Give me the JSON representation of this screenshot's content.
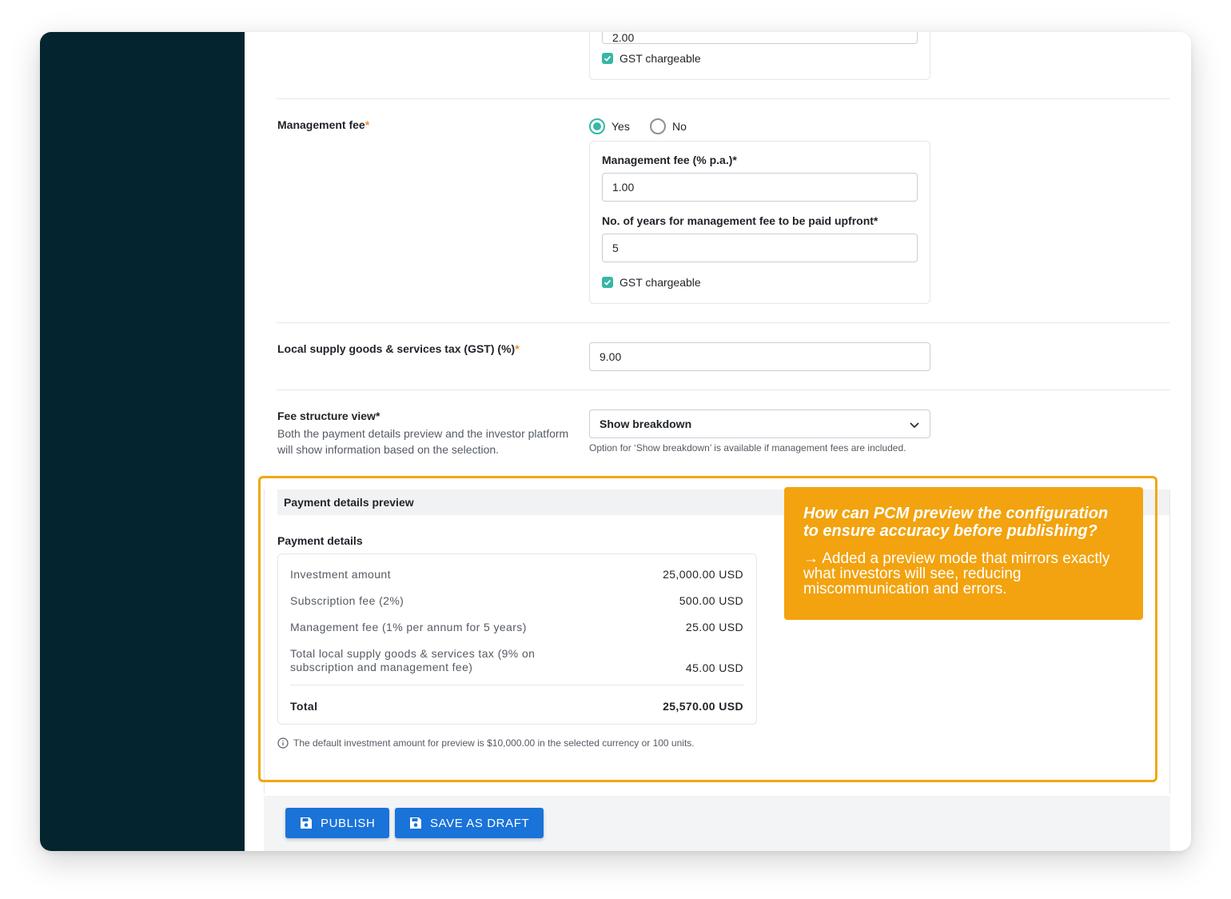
{
  "top_section": {
    "partial_input_value": "2.00",
    "gst_chargeable_label": "GST chargeable"
  },
  "management_fee": {
    "label": "Management fee",
    "required_mark": "*",
    "radio_yes": "Yes",
    "radio_no": "No",
    "selected": "Yes",
    "percent_label": "Management fee (% p.a.)*",
    "percent_value": "1.00",
    "years_label": "No. of years for management fee to be paid upfront*",
    "years_value": "5",
    "gst_chargeable_label": "GST chargeable"
  },
  "gst": {
    "label": "Local supply goods & services tax (GST) (%)",
    "required_mark": "*",
    "value": "9.00"
  },
  "fee_structure": {
    "label": "Fee structure view*",
    "helper": "Both the payment details preview and the investor platform will show information based on the selection.",
    "selected": "Show breakdown",
    "note": "Option for ‘Show breakdown’ is available if management fees are included."
  },
  "preview": {
    "header": "Payment details preview",
    "subheader": "Payment details",
    "rows": [
      {
        "label": "Investment amount",
        "value": "25,000.00 USD"
      },
      {
        "label": "Subscription fee (2%)",
        "value": "500.00 USD"
      },
      {
        "label": "Management fee (1% per annum for 5 years)",
        "value": "25.00 USD"
      },
      {
        "label": "Total local supply goods & services tax (9% on subscription and management fee)",
        "value": "45.00 USD"
      }
    ],
    "total_label": "Total",
    "total_value": "25,570.00 USD",
    "info_note": "The default investment amount for preview is $10,000.00 in the selected currency or 100 units."
  },
  "callout": {
    "question": "How can PCM preview the configuration to ensure accuracy before publishing?",
    "answer": "→ Added a preview mode that mirrors exactly what investors will see, reducing miscommunication and errors."
  },
  "footer": {
    "publish_label": "PUBLISH",
    "save_draft_label": "SAVE AS DRAFT"
  },
  "colors": {
    "sidebar": "#04252f",
    "accent_teal": "#35b8a6",
    "required": "#f08c3a",
    "highlight": "#f0a80e",
    "callout_bg": "#f2a30f",
    "button": "#1a73d9"
  },
  "icons": [
    "check-icon",
    "chevron-down-icon",
    "info-icon",
    "save-icon"
  ]
}
